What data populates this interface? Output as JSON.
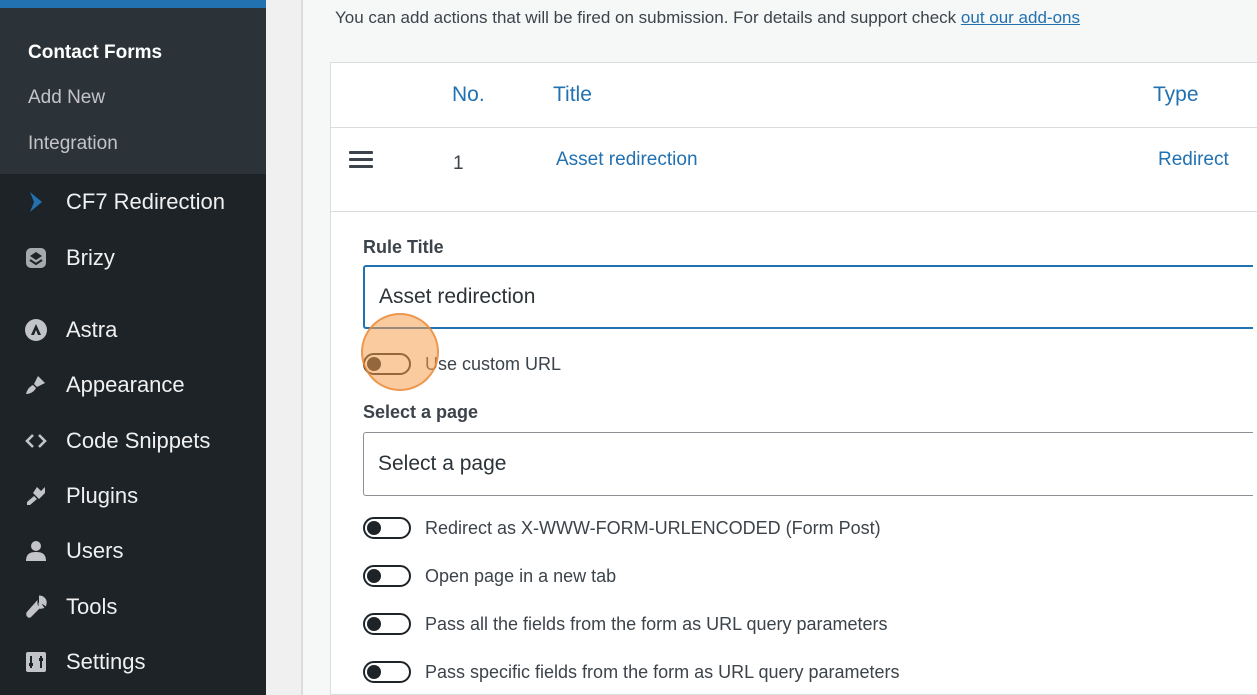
{
  "sidebar": {
    "submenu": [
      {
        "label": "Contact Forms",
        "current": true
      },
      {
        "label": "Add New",
        "current": false
      },
      {
        "label": "Integration",
        "current": false
      }
    ],
    "menu": [
      {
        "label": "CF7 Redirection",
        "icon": "chevron-right-icon"
      },
      {
        "label": "Brizy",
        "icon": "brizy-icon"
      },
      {
        "label": "Astra",
        "icon": "astra-icon"
      },
      {
        "label": "Appearance",
        "icon": "paintbrush-icon"
      },
      {
        "label": "Code Snippets",
        "icon": "code-icon"
      },
      {
        "label": "Plugins",
        "icon": "plugin-icon"
      },
      {
        "label": "Users",
        "icon": "users-icon"
      },
      {
        "label": "Tools",
        "icon": "wrench-icon"
      },
      {
        "label": "Settings",
        "icon": "settings-icon"
      }
    ]
  },
  "main": {
    "intro_text": "You can add actions that will be fired on submission. For details and support check ",
    "intro_link": "out our add-ons",
    "table": {
      "headers": {
        "no": "No.",
        "title": "Title",
        "type": "Type"
      },
      "rows": [
        {
          "no": "1",
          "title": "Asset redirection",
          "type": "Redirect"
        }
      ]
    },
    "rule_title_label": "Rule Title",
    "rule_title_value": "Asset redirection",
    "use_custom_url_label": "Use custom URL",
    "select_page_label": "Select a page",
    "select_page_placeholder": "Select a page",
    "toggles": [
      "Redirect as X-WWW-FORM-URLENCODED (Form Post)",
      "Open page in a new tab",
      "Pass all the fields from the form as URL query parameters",
      "Pass specific fields from the form as URL query parameters"
    ]
  },
  "colors": {
    "sidebar_bg": "#1d2327",
    "submenu_bg": "#2c3338",
    "accent": "#2271b1",
    "click_indicator": "#f5a050"
  }
}
